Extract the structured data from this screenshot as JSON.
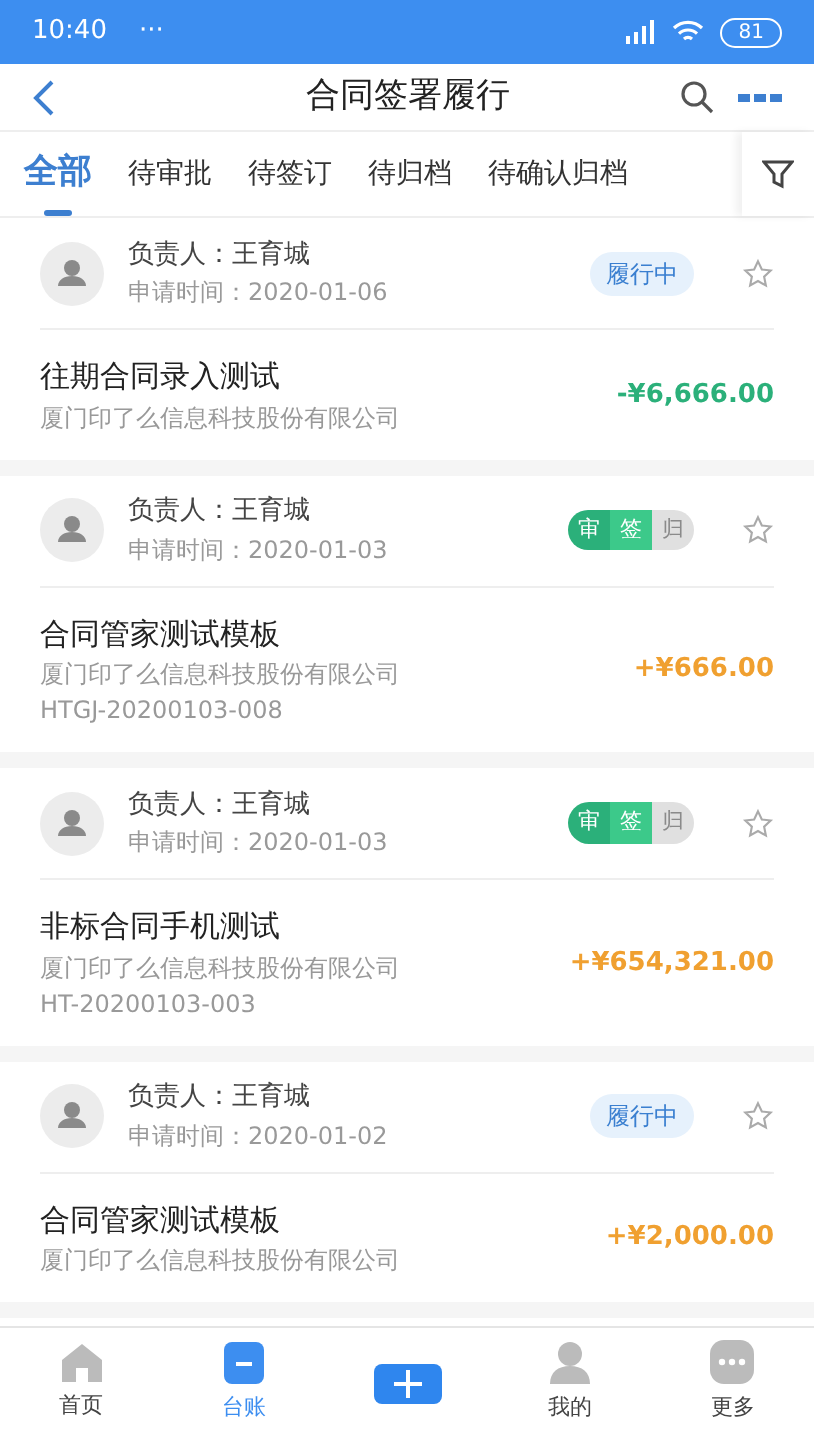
{
  "status_bar": {
    "time": "10:40",
    "dots": "···",
    "battery": "81"
  },
  "header": {
    "title": "合同签署履行"
  },
  "tabs": [
    {
      "label": "全部",
      "selected": true
    },
    {
      "label": "待审批",
      "selected": false
    },
    {
      "label": "待签订",
      "selected": false
    },
    {
      "label": "待归档",
      "selected": false
    },
    {
      "label": "待确认归档",
      "selected": false
    }
  ],
  "contracts": [
    {
      "owner": "负责人：王育城",
      "date": "申请时间：2020-01-06",
      "status": {
        "kind": "badge",
        "label": "履行中"
      },
      "starred": false,
      "title": "往期合同录入测试",
      "company": "厦门印了么信息科技股份有限公司",
      "amount": "-¥6,666.00",
      "color": "#2bb07a"
    },
    {
      "owner": "负责人：王育城",
      "date": "申请时间：2020-01-03",
      "status": {
        "kind": "steps",
        "steps": [
          {
            "label": "审",
            "done": true
          },
          {
            "label": "签",
            "done": true
          },
          {
            "label": "归",
            "done": false
          }
        ]
      },
      "starred": false,
      "title": "合同管家测试模板",
      "company": "厦门印了么信息科技股份有限公司",
      "code": "HTGJ-20200103-008",
      "amount": "+¥666.00",
      "color": "#f0a030"
    },
    {
      "owner": "负责人：王育城",
      "date": "申请时间：2020-01-03",
      "status": {
        "kind": "steps",
        "steps": [
          {
            "label": "审",
            "done": true
          },
          {
            "label": "签",
            "done": true
          },
          {
            "label": "归",
            "done": false
          }
        ]
      },
      "starred": false,
      "title": "非标合同手机测试",
      "company": "厦门印了么信息科技股份有限公司",
      "code": "HT-20200103-003",
      "amount": "+¥654,321.00",
      "color": "#f0a030"
    },
    {
      "owner": "负责人：王育城",
      "date": "申请时间：2020-01-02",
      "status": {
        "kind": "badge",
        "label": "履行中"
      },
      "starred": false,
      "title": "合同管家测试模板",
      "company": "厦门印了么信息科技股份有限公司",
      "amount": "+¥2,000.00",
      "color": "#f0a030"
    }
  ],
  "nav": [
    {
      "kind": "home",
      "label": "首页",
      "selected": false
    },
    {
      "kind": "ledger",
      "label": "台账",
      "selected": true
    },
    {
      "kind": "add"
    },
    {
      "kind": "me",
      "label": "我的",
      "selected": false
    },
    {
      "kind": "more",
      "label": "更多",
      "selected": false
    }
  ]
}
